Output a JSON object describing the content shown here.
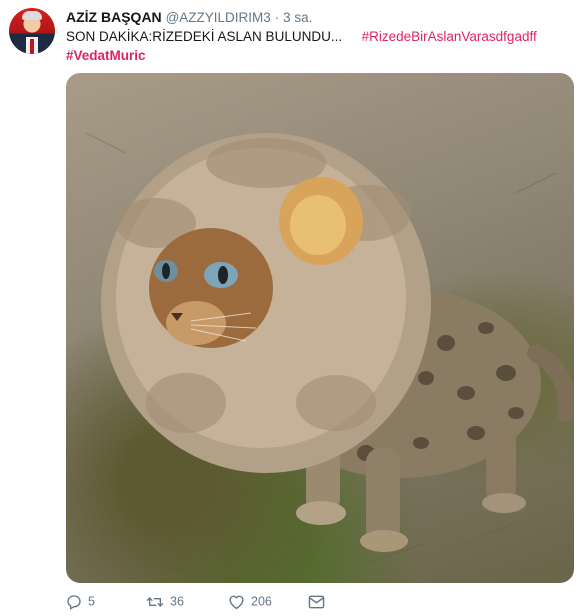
{
  "tweet": {
    "author": {
      "display_name": "AZİZ BAŞQAN",
      "handle": "@AZZYILDIRIM3",
      "separator": "·",
      "time": "3 sa."
    },
    "text_line1": "SON DAKİKA:RİZEDEKİ ASLAN BULUNDU...",
    "hashtag1": "#RizedeBirAslanVarasdfgadff",
    "hashtag2": "#VedatMuric",
    "media": {
      "description_icon": "cat-in-lion-mane-photo"
    },
    "actions": {
      "reply_count": "5",
      "retweet_count": "36",
      "like_count": "206"
    },
    "colors": {
      "hashtag": "#e0245e",
      "meta": "#657786",
      "text": "#14171a"
    }
  }
}
